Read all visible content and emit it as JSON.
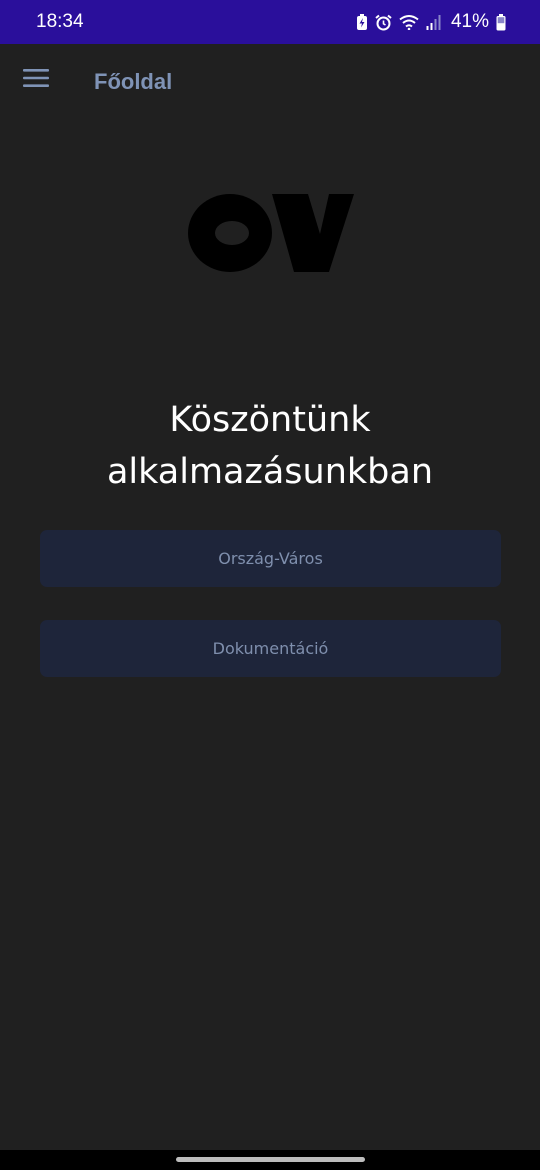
{
  "status_bar": {
    "time": "18:34",
    "battery_percent": "41%",
    "icons": [
      "battery-saver-icon",
      "alarm-icon",
      "wifi-icon",
      "signal-icon",
      "battery-icon"
    ]
  },
  "app_bar": {
    "title": "Főoldal",
    "menu_icon": "hamburger-menu-icon"
  },
  "logo": {
    "text": "OV"
  },
  "main": {
    "welcome_line1": "Köszöntünk",
    "welcome_line2": "alkalmazásunkban",
    "buttons": [
      {
        "label": "Ország-Város"
      },
      {
        "label": "Dokumentáció"
      }
    ]
  },
  "colors": {
    "status_bar_bg": "#2a0f9b",
    "background": "#202020",
    "app_title": "#7f93b6",
    "button_bg": "#1e253a",
    "button_text": "#7f8fad",
    "welcome_text": "#ffffff",
    "logo": "#000000"
  }
}
